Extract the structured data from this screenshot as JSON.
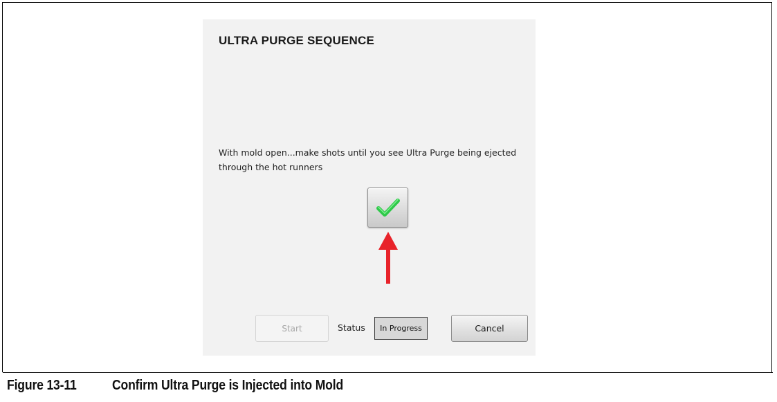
{
  "dialog": {
    "title": "ULTRA PURGE SEQUENCE",
    "instruction": "With mold open...make shots until you see Ultra Purge being ejected through the hot runners",
    "confirm_icon": "checkmark-icon",
    "pointer_icon": "arrow-up-icon",
    "start_label": "Start",
    "status_label": "Status",
    "status_value": "In Progress",
    "cancel_label": "Cancel"
  },
  "caption": {
    "number": "Figure 13-11",
    "text": "Confirm Ultra Purge is Injected into Mold"
  },
  "colors": {
    "check": "#2fc84a",
    "arrow": "#e8232a",
    "dialog_bg": "#f2f2f2"
  }
}
